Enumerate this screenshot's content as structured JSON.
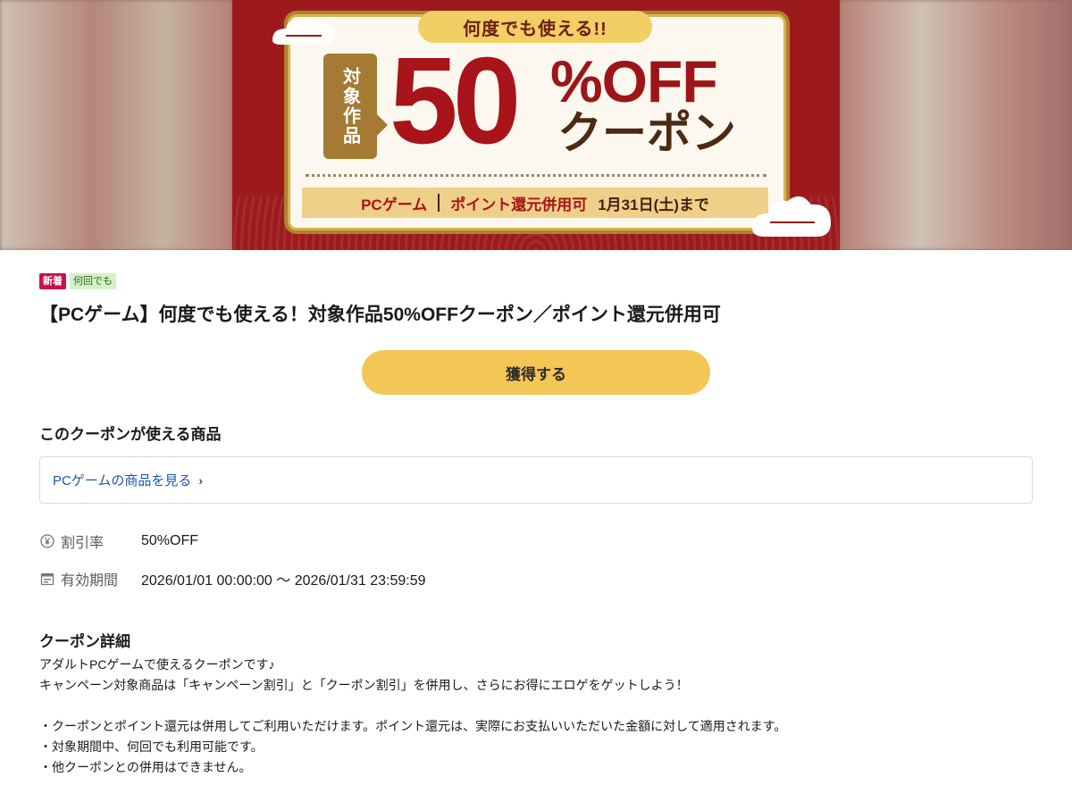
{
  "banner": {
    "top_tag": "何度でも使える!!",
    "target_label": "対象作品",
    "big_number": "50",
    "off_text": "%OFF",
    "coupon_text": "クーポン",
    "bar_category": "PCゲーム",
    "bar_points": "ポイント還元併用可",
    "bar_deadline": "1月31日(土)まで"
  },
  "badges": {
    "new": "新着",
    "any_time": "何回でも"
  },
  "title": "【PCゲーム】何度でも使える！対象作品50%OFFクーポン／ポイント還元併用可",
  "get_button": "獲得する",
  "products": {
    "section_title": "このクーポンが使える商品",
    "link_text": "PCゲームの商品を見る",
    "link_chevron": "›"
  },
  "info": {
    "discount_label": "割引率",
    "discount_value": "50%OFF",
    "period_label": "有効期間",
    "period_value": "2026/01/01 00:00:00 〜 2026/01/31 23:59:59"
  },
  "details": {
    "title": "クーポン詳細",
    "lines": [
      "アダルトPCゲームで使えるクーポンです♪",
      "キャンペーン対象商品は「キャンペーン割引」と「クーポン割引」を併用し、さらにお得にエロゲをゲットしよう！",
      "",
      "・クーポンとポイント還元は併用してご利用いただけます。ポイント還元は、実際にお支払いいただいた金額に対して適用されます。",
      "・対象期間中、何回でも利用可能です。",
      "・他クーポンとの併用はできません。"
    ]
  },
  "icons": {
    "yen": "yen-circle-icon",
    "calendar": "calendar-icon",
    "chevron": "chevron-right-icon"
  },
  "colors": {
    "button": "#f4c656",
    "link": "#1d55b0",
    "badge_new": "#c4134a",
    "badge_any": "#d6f0c8",
    "banner_red": "#9c1a1c"
  }
}
